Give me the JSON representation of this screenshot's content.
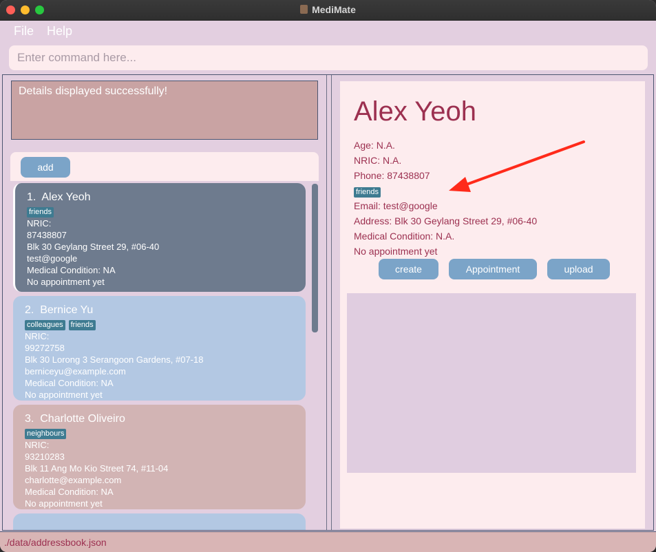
{
  "window": {
    "title": "MediMate"
  },
  "menu": {
    "file": "File",
    "help": "Help"
  },
  "command": {
    "placeholder": "Enter command here..."
  },
  "result": {
    "message": "Details displayed successfully!"
  },
  "list_panel": {
    "add_label": "add"
  },
  "persons": [
    {
      "index": "1.",
      "name": "Alex Yeoh",
      "tags": [
        "friends"
      ],
      "nric": "NRIC:",
      "phone": "87438807",
      "address": "Blk 30 Geylang Street 29, #06-40",
      "email": "test@google",
      "medical": "Medical Condition: NA",
      "appointment": "No appointment yet"
    },
    {
      "index": "2.",
      "name": "Bernice Yu",
      "tags": [
        "colleagues",
        "friends"
      ],
      "nric": "NRIC:",
      "phone": "99272758",
      "address": "Blk 30 Lorong 3 Serangoon Gardens, #07-18",
      "email": "berniceyu@example.com",
      "medical": "Medical Condition: NA",
      "appointment": "No appointment yet"
    },
    {
      "index": "3.",
      "name": "Charlotte Oliveiro",
      "tags": [
        "neighbours"
      ],
      "nric": "NRIC:",
      "phone": "93210283",
      "address": "Blk 11 Ang Mo Kio Street 74, #11-04",
      "email": "charlotte@example.com",
      "medical": "Medical Condition: NA",
      "appointment": "No appointment yet"
    }
  ],
  "detail": {
    "name": "Alex Yeoh",
    "age": "Age: N.A.",
    "nric": "NRIC: N.A.",
    "phone": "Phone: 87438807",
    "tag": "friends",
    "email": "Email: test@google",
    "address": "Address: Blk 30 Geylang Street 29, #06-40",
    "medical": "Medical Condition: N.A.",
    "appointment": "No appointment yet",
    "create_label": "create",
    "appointment_label": "Appointment",
    "upload_label": "upload"
  },
  "status": {
    "path": "./data/addressbook.json"
  },
  "colors": {
    "window_bg": "#e3cfe0",
    "accent_text": "#9c3050",
    "button": "#7ba4c8",
    "tag": "#3e7b91",
    "selected_card": "#6e7b8e",
    "card_blue": "#b3c8e3",
    "card_pink": "#d2b4b4",
    "arrow": "#ff2a1a"
  },
  "icons": {
    "arrow": "red-arrow-annotation",
    "app": "medimate-app-icon"
  }
}
